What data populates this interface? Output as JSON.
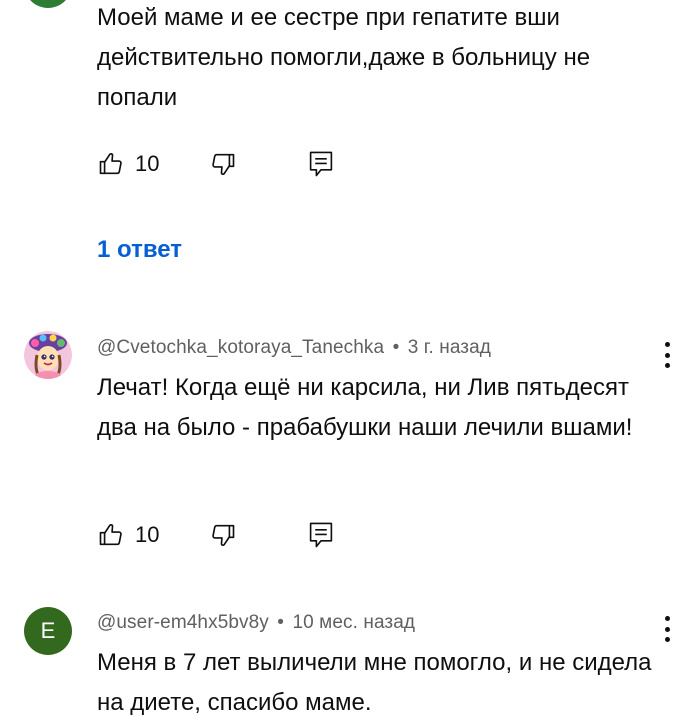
{
  "comments": [
    {
      "author": "",
      "age": "",
      "text": "Моей маме и ее сестре при гепатите вши действительно помогли,даже в больницу не попали",
      "likes": "10",
      "replies_label": "1 ответ",
      "avatar_color": "#2e7d32"
    },
    {
      "author": "@Cvetochka_kotoraya_Tanechka",
      "age": "3 г. назад",
      "text": "Лечат! Когда ещё ни карсила, ни Лив пятьдесят два на было - прабабушки наши лечили вшами!",
      "likes": "10",
      "avatar_color": "#f3c6dd"
    },
    {
      "author": "@user-em4hx5bv8y",
      "age": "10 мес. назад",
      "text": "Меня в 7 лет выличели мне помогло, и не сидела на диете, спасибо маме.",
      "avatar_letter": "E",
      "avatar_color": "#33691e"
    }
  ],
  "meta_separator": "•",
  "icons": [
    "thumb-up-icon",
    "thumb-down-icon",
    "reply-comment-icon",
    "more-options-icon"
  ],
  "colors": {
    "text": "#0f0f0f",
    "meta": "#606060",
    "link": "#065fd4",
    "background": "#ffffff"
  }
}
